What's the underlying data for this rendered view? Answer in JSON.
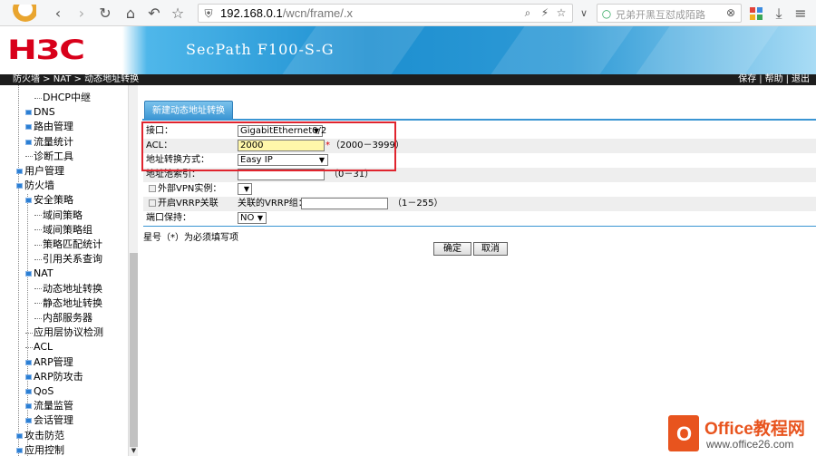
{
  "browser": {
    "url_host": "192.168.0.1",
    "url_path": "/wcn/frame/.x",
    "search_placeholder": "兄弟开黑互怼成陌路",
    "icons": [
      "browser-logo-icon",
      "back-icon",
      "forward-icon",
      "reload-icon",
      "home-icon",
      "undo-icon",
      "star-icon",
      "shield-icon",
      "search-icon",
      "lightning-icon",
      "bookmark-star-icon",
      "dropdown-icon",
      "close-icon",
      "apps-icon",
      "download-icon",
      "menu-icon"
    ]
  },
  "banner": {
    "logo": "H3C",
    "product": "SecPath F100-S-G"
  },
  "nav": {
    "breadcrumb": "防火墙 > NAT > 动态地址转换",
    "links": [
      "保存",
      "帮助",
      "退出"
    ]
  },
  "sidebar": {
    "items": [
      {
        "label": "DHCP中继",
        "kind": "leaf"
      },
      {
        "label": "DNS",
        "kind": "folder"
      },
      {
        "label": "路由管理",
        "kind": "folder"
      },
      {
        "label": "流量统计",
        "kind": "folder"
      },
      {
        "label": "诊断工具",
        "kind": "leaf"
      },
      {
        "label": "用户管理",
        "kind": "folder"
      },
      {
        "label": "防火墙",
        "kind": "folder"
      },
      {
        "label": "安全策略",
        "kind": "folder"
      },
      {
        "label": "域间策略",
        "kind": "leaf"
      },
      {
        "label": "域间策略组",
        "kind": "leaf"
      },
      {
        "label": "策略匹配统计",
        "kind": "leaf"
      },
      {
        "label": "引用关系查询",
        "kind": "leaf"
      },
      {
        "label": "NAT",
        "kind": "folder"
      },
      {
        "label": "动态地址转换",
        "kind": "leaf"
      },
      {
        "label": "静态地址转换",
        "kind": "leaf"
      },
      {
        "label": "内部服务器",
        "kind": "leaf"
      },
      {
        "label": "应用层协议检测",
        "kind": "leaf"
      },
      {
        "label": "ACL",
        "kind": "leaf"
      },
      {
        "label": "ARP管理",
        "kind": "folder"
      },
      {
        "label": "ARP防攻击",
        "kind": "folder"
      },
      {
        "label": "QoS",
        "kind": "folder"
      },
      {
        "label": "流量监管",
        "kind": "folder"
      },
      {
        "label": "会话管理",
        "kind": "folder"
      },
      {
        "label": "攻击防范",
        "kind": "folder"
      },
      {
        "label": "应用控制",
        "kind": "folder"
      }
    ]
  },
  "form": {
    "tab_label": "新建动态地址转换",
    "interface_label": "接口：",
    "interface_value": "GigabitEthernet0/2",
    "acl_label": "ACL：",
    "acl_value": "2000",
    "acl_required": "*",
    "acl_hint": "（2000－3999）",
    "nat_mode_label": "地址转换方式：",
    "nat_mode_value": "Easy IP",
    "pool_label": "地址池索引：",
    "pool_value": "",
    "pool_hint": "（0－31）",
    "vpn_label": "外部VPN实例：",
    "vpn_value": "",
    "vrrp_label": "开启VRRP关联",
    "vrrp_group_label": "关联的VRRP组：",
    "vrrp_group_value": "",
    "vrrp_hint": "（1－255）",
    "port_keep_label": "端口保持：",
    "port_keep_value": "NO",
    "note": "星号（*）为必须填写项",
    "ok_label": "确定",
    "cancel_label": "取消"
  },
  "watermark": {
    "brand": "Office教程网",
    "site": "www.office26.com",
    "doc_letter": "O"
  },
  "colors": {
    "logo_red": "#d8001a",
    "highlight_red": "#e0242e",
    "tab_blue": "#3a95d3",
    "acl_yellow": "#fff7aa",
    "watermark_orange": "#e8541e"
  }
}
